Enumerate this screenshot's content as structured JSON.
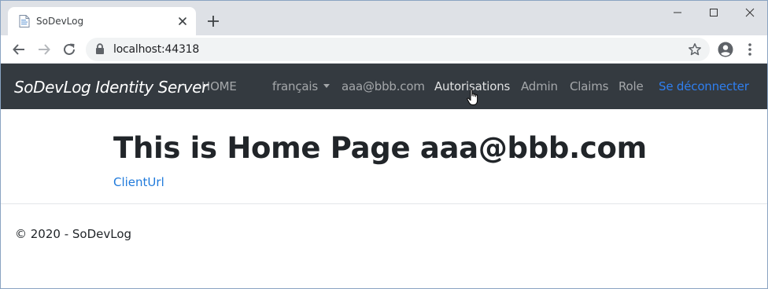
{
  "browser": {
    "tab_title": "SoDevLog",
    "url": "localhost:44318"
  },
  "navbar": {
    "brand": "SoDevLog Identity Server",
    "home": "HOME",
    "language": "français",
    "user": "aaa@bbb.com",
    "authorizations": "Autorisations",
    "admin": "Admin",
    "claims": "Claims",
    "role": "Role",
    "logout": "Se déconnecter"
  },
  "main": {
    "title": "This is Home Page aaa@bbb.com",
    "client_link": "ClientUrl"
  },
  "footer": {
    "text": "© 2020 - SoDevLog"
  },
  "colors": {
    "navbar_bg": "#343a40",
    "link_blue": "#1f7adb",
    "logout_blue": "#2f7ff0",
    "tabstrip_bg": "#dee1e6"
  }
}
